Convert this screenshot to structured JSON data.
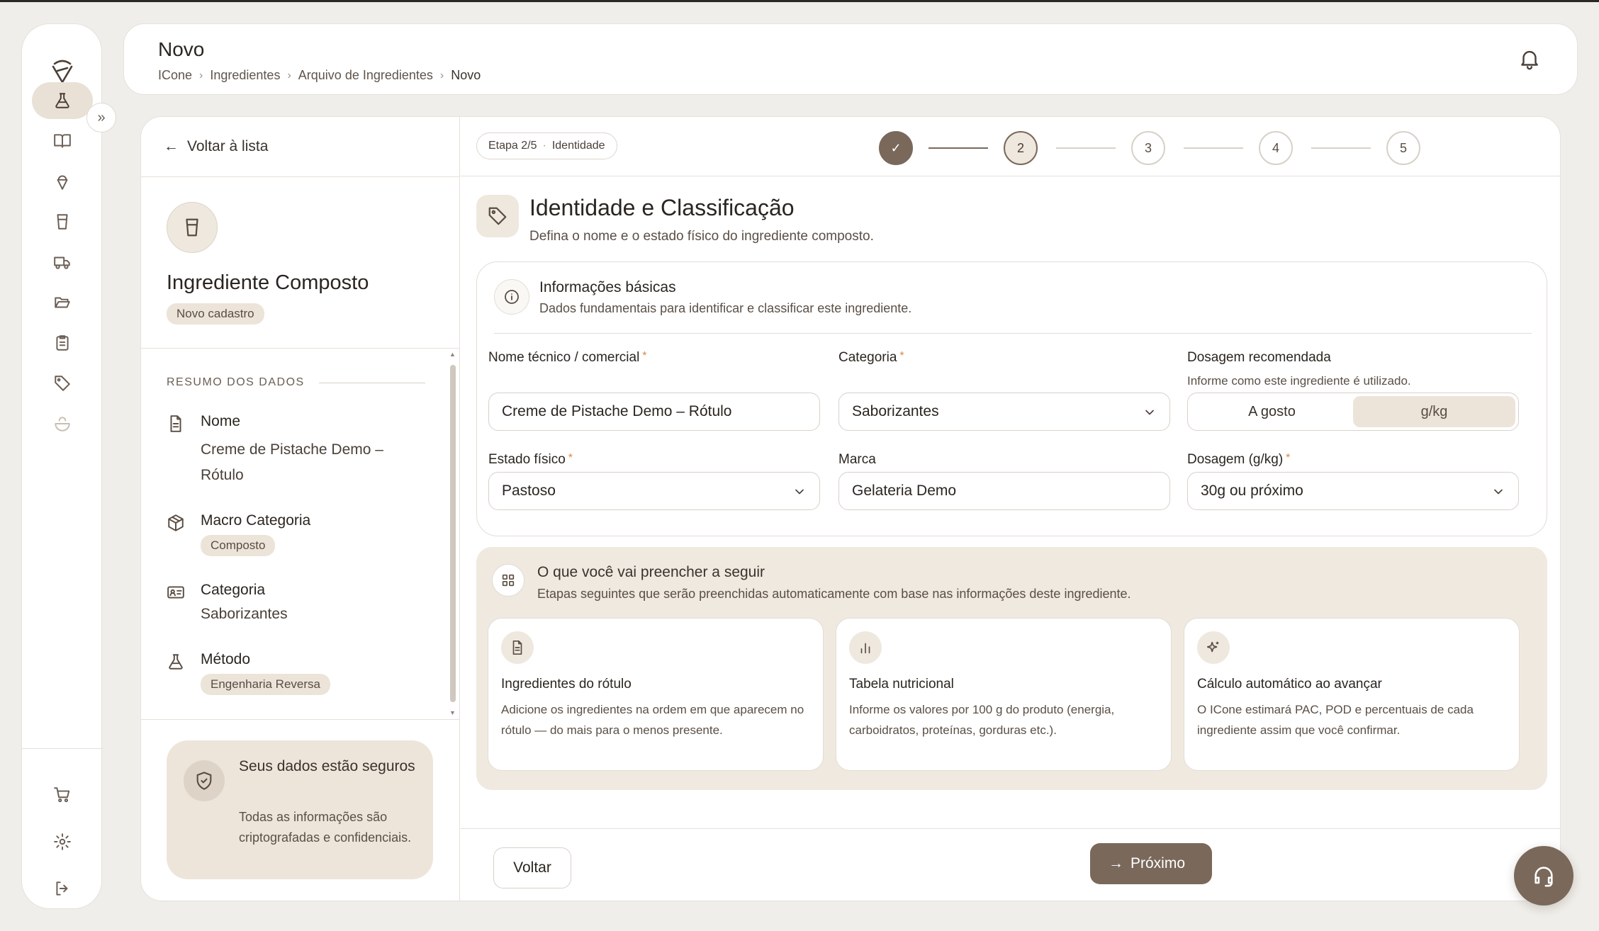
{
  "header": {
    "title": "Novo",
    "breadcrumbs": [
      "ICone",
      "Ingredientes",
      "Arquivo de Ingredientes",
      "Novo"
    ]
  },
  "sidebar": {
    "items": [
      {
        "icon": "flask-icon",
        "active": true
      },
      {
        "icon": "book-icon"
      },
      {
        "icon": "ice-cream-icon"
      },
      {
        "icon": "cup-icon"
      },
      {
        "icon": "truck-icon"
      },
      {
        "icon": "folder-open-icon"
      },
      {
        "icon": "clipboard-icon"
      },
      {
        "icon": "tag-icon"
      },
      {
        "icon": "bowl-icon"
      }
    ],
    "bottom_items": [
      {
        "icon": "cart-icon"
      },
      {
        "icon": "gear-icon"
      },
      {
        "icon": "logout-icon"
      }
    ]
  },
  "left_panel": {
    "back_label": "Voltar à lista",
    "title": "Ingrediente Composto",
    "badge": "Novo cadastro",
    "summary_heading": "RESUMO DOS DADOS",
    "summary": {
      "nome_label": "Nome",
      "nome_value": "Creme de Pistache Demo – Rótulo",
      "macro_label": "Macro Categoria",
      "macro_value": "Composto",
      "categoria_label": "Categoria",
      "categoria_value": "Saborizantes",
      "metodo_label": "Método",
      "metodo_value": "Engenharia Reversa"
    },
    "secure_title": "Seus dados estão seguros",
    "secure_desc": "Todas as informações são criptografadas e confidenciais."
  },
  "stepper": {
    "tag_step": "Etapa 2/5",
    "tag_name": "Identidade",
    "steps": [
      "✓",
      "2",
      "3",
      "4",
      "5"
    ],
    "current_index": 1
  },
  "section": {
    "title": "Identidade e Classificação",
    "subtitle": "Defina o nome e o estado físico do ingrediente composto."
  },
  "basic_info": {
    "title": "Informações básicas",
    "subtitle": "Dados fundamentais para identificar e classificar este ingrediente.",
    "nome_label": "Nome técnico / comercial",
    "nome_value": "Creme de Pistache Demo – Rótulo",
    "categoria_label": "Categoria",
    "categoria_value": "Saborizantes",
    "dosagem_rec_label": "Dosagem recomendada",
    "dosagem_rec_help": "Informe como este ingrediente é utilizado.",
    "dosagem_options": [
      "A gosto",
      "g/kg"
    ],
    "dosagem_selected": "g/kg",
    "estado_label": "Estado físico",
    "estado_value": "Pastoso",
    "marca_label": "Marca",
    "marca_value": "Gelateria Demo",
    "dosagem_label": "Dosagem (g/kg)",
    "dosagem_value": "30g ou próximo",
    "required_mark": "*"
  },
  "next_steps": {
    "title": "O que você vai preencher a seguir",
    "subtitle": "Etapas seguintes que serão preenchidas automaticamente com base nas informações deste ingrediente.",
    "cards": [
      {
        "title": "Ingredientes do rótulo",
        "desc": "Adicione os ingredientes na ordem em que aparecem no rótulo — do mais para o menos presente."
      },
      {
        "title": "Tabela nutricional",
        "desc": "Informe os valores por 100 g do produto (energia, carboidratos, proteínas, gorduras etc.)."
      },
      {
        "title": "Cálculo automático ao avançar",
        "desc": "O ICone estimará PAC, POD e percentuais de cada ingrediente assim que você confirmar."
      }
    ]
  },
  "footer": {
    "back_label": "Voltar",
    "next_label": "Próximo"
  },
  "colors": {
    "accent": "#7a685b",
    "accent_soft": "#ece4d9",
    "background": "#f0eeea",
    "required": "#d48a4a"
  }
}
